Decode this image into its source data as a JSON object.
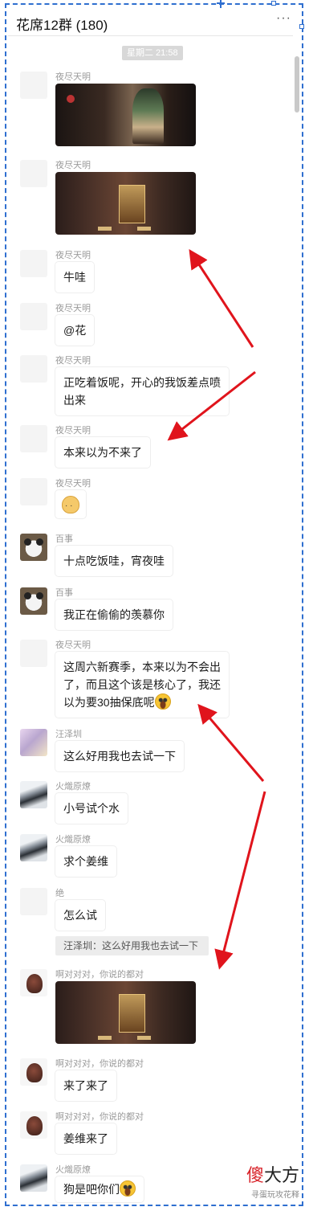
{
  "header": {
    "title": "花席12群 (180)",
    "more_icon": "more-dots-icon"
  },
  "timestamp": "星期二 21:58",
  "messages": [
    {
      "sender": "夜尽天明",
      "type": "image"
    },
    {
      "sender": "夜尽天明",
      "type": "image"
    },
    {
      "sender": "夜尽天明",
      "text": "牛哇"
    },
    {
      "sender": "夜尽天明",
      "text": "@花"
    },
    {
      "sender": "夜尽天明",
      "text_line1": "正吃着饭呢，开心的我饭差点喷",
      "text_line2": "出来"
    },
    {
      "sender": "夜尽天明",
      "text": "本来以为不来了"
    },
    {
      "sender": "夜尽天明",
      "type": "emoji"
    },
    {
      "sender": "百事",
      "text": "十点吃饭哇，宵夜哇"
    },
    {
      "sender": "百事",
      "text": "我正在偷偷的羡慕你"
    },
    {
      "sender": "夜尽天明",
      "text_line1": "这周六新赛季，本来以为不会出",
      "text_line2": "了，而且这个该是核心了，我还",
      "text_line3": "以为要30抽保底呢"
    },
    {
      "sender": "汪泽圳",
      "text": "这么好用我也去试一下"
    },
    {
      "sender": "火熾原燎",
      "text": "小号试个水"
    },
    {
      "sender": "火熾原燎",
      "text": "求个姜维"
    },
    {
      "sender": "绝",
      "text": "怎么试"
    },
    {
      "quote": "汪泽圳：这么好用我也去试一下"
    },
    {
      "sender": "啊对对对，你说的都对",
      "type": "image"
    },
    {
      "sender": "啊对对对，你说的都对",
      "text": "来了来了"
    },
    {
      "sender": "啊对对对，你说的都对",
      "text": "姜维来了"
    },
    {
      "sender": "火熾原燎",
      "text": "狗是吧你们"
    }
  ],
  "watermark": {
    "brand_a": "傻",
    "brand_b": "大方",
    "source": "寻蛋玩攻花释"
  },
  "colors": {
    "selection": "#2f6fd0",
    "arrow": "#e0141c",
    "bubble": "#ffffff"
  }
}
